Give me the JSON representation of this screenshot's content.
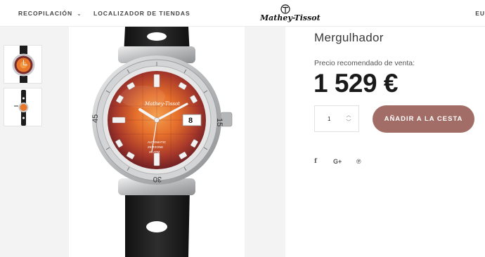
{
  "header": {
    "nav": [
      {
        "label": "RECOPILACIÓN",
        "has_dropdown": true
      },
      {
        "label": "LOCALIZADOR DE TIENDAS",
        "has_dropdown": false
      }
    ],
    "logo": "Mathey-Tissot",
    "language": "EU"
  },
  "icons": {
    "dropdown": "chevron-down-icon",
    "qty_up": "chevron-up-icon",
    "qty_down": "chevron-down-icon",
    "facebook": "facebook-icon",
    "google_plus": "google-plus-icon",
    "pinterest": "pinterest-icon"
  },
  "gallery": {
    "thumbnails": [
      "watch-front-thumbnail",
      "watch-side-thumbnail"
    ],
    "main": "orange-dial-diver-watch-image",
    "watch_text": {
      "brand": "Mathey-Tissot",
      "date": "8",
      "bezel_left": "45",
      "bezel_right": "15",
      "bezel_bottom": "30",
      "dial_line1": "AUTOMATIC",
      "dial_line2": "ZEITZONE",
      "dial_line3": "20 ATM"
    }
  },
  "product": {
    "title": "Mergulhador",
    "price_label": "Precio recomendado de venta:",
    "price": "1 529 €",
    "quantity": "1",
    "add_to_cart": "AÑADIR A LA CESTA",
    "social": [
      "f",
      "G+",
      "℗"
    ]
  },
  "colors": {
    "accent_button": "#a26d66",
    "dial_center": "#f0882e",
    "dial_edge": "#5a1722",
    "strap": "#1c1c1c",
    "steel": "#c9cacc"
  }
}
